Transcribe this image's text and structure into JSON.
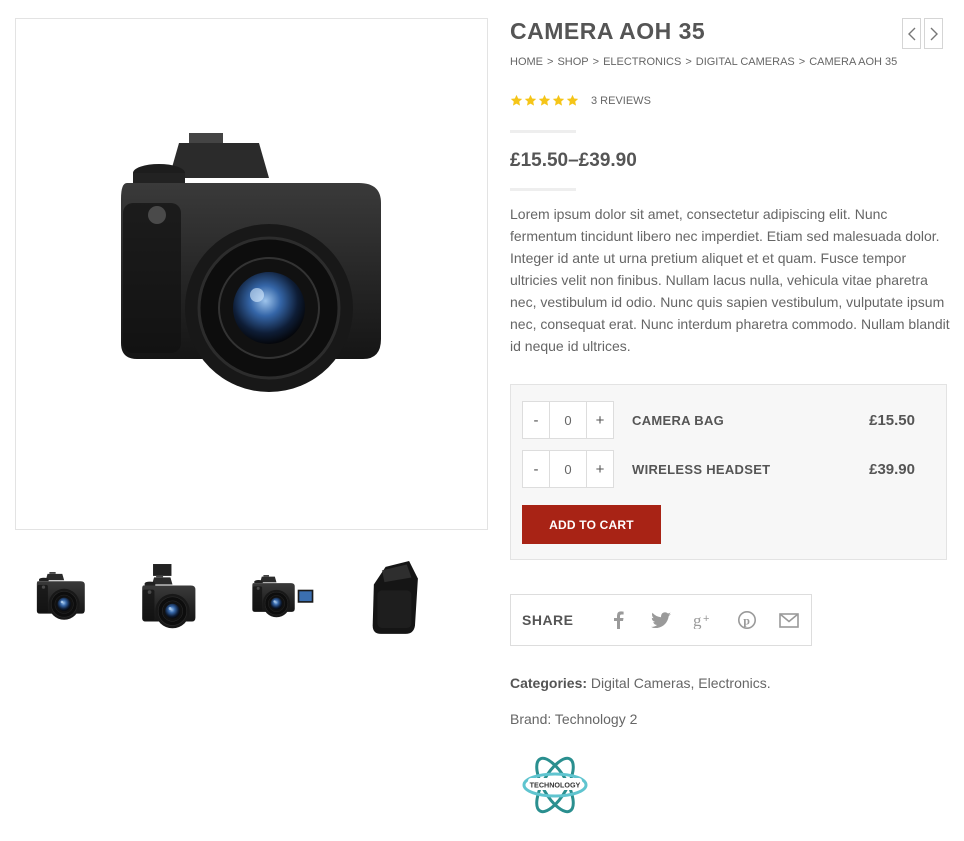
{
  "product": {
    "title": "CAMERA AOH 35",
    "breadcrumb": [
      "HOME",
      "SHOP",
      "ELECTRONICS",
      "DIGITAL CAMERAS",
      "CAMERA AOH 35"
    ],
    "breadcrumb_sep": ">",
    "rating": 5,
    "reviews_label": "3 REVIEWS",
    "price_range": "£15.50–£39.90",
    "description": "Lorem ipsum dolor sit amet, consectetur adipiscing elit. Nunc fermentum tincidunt libero nec imperdiet. Etiam sed malesuada dolor. Integer id ante ut urna pretium aliquet et et quam. Fusce tempor ultricies velit non finibus. Nullam lacus nulla, vehicula vitae pharetra nec, vestibulum id odio. Nunc quis sapien vestibulum, vulputate ipsum nec, consequat erat. Nunc interdum pharetra commodo. Nullam blandit id neque id ultrices."
  },
  "grouped": {
    "items": [
      {
        "minus": "-",
        "qty": "0",
        "plus": "+",
        "name": "CAMERA BAG",
        "price": "£15.50"
      },
      {
        "minus": "-",
        "qty": "0",
        "plus": "+",
        "name": "WIRELESS HEADSET",
        "price": "£39.90"
      }
    ],
    "add_to_cart": "ADD TO CART"
  },
  "share": {
    "label": "SHARE",
    "icons": [
      "facebook-icon",
      "twitter-icon",
      "google-plus-icon",
      "pinterest-icon",
      "email-icon"
    ]
  },
  "meta": {
    "categories_label": "Categories:",
    "categories": [
      "Digital Cameras",
      "Electronics"
    ],
    "categories_sep": ", ",
    "categories_end": ".",
    "brand_text": "Brand: Technology 2",
    "brand_logo_text": "TECHNOLOGY"
  },
  "gallery": {
    "thumbnails": [
      "camera-front-thumbnail",
      "camera-flash-thumbnail",
      "camera-screen-thumbnail",
      "camera-bag-thumbnail"
    ]
  },
  "colors": {
    "accent": "#a82315",
    "star": "#f5c518",
    "text": "#555555"
  }
}
